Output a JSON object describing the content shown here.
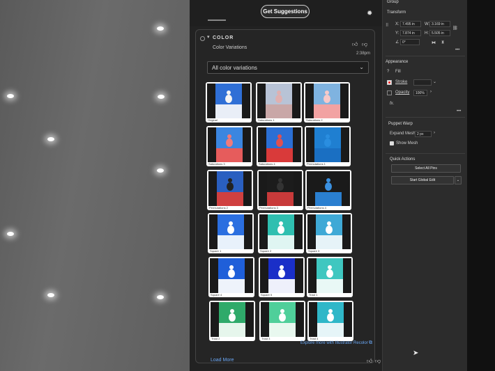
{
  "suggestions": {
    "get_label": "Get Suggestions"
  },
  "color_section": {
    "title": "COLOR",
    "subtitle": "Color Variations",
    "time": "2:38pm",
    "dropdown_value": "All color variations",
    "tiles": [
      {
        "caption": "Original",
        "sky": "#2f6fd6",
        "ground": "#e9eef7",
        "snow": "#f4f4f4",
        "bg": "#ffffff"
      },
      {
        "caption": "Saturations 1",
        "sky": "#b8c3d6",
        "ground": "#c9a7a7",
        "snow": "#e0b0b0",
        "bg": "#ffffff"
      },
      {
        "caption": "Saturations 2",
        "sky": "#7fb3e0",
        "ground": "#f2a2a2",
        "snow": "#f7c9c9",
        "bg": "#ffffff"
      },
      {
        "caption": "Saturations 3",
        "sky": "#3b86e0",
        "ground": "#e65c5c",
        "snow": "#f07a7a",
        "bg": "#ffffff"
      },
      {
        "caption": "Saturations 4",
        "sky": "#2b6fd4",
        "ground": "#d93a3a",
        "snow": "#e05050",
        "bg": "#ffffff"
      },
      {
        "caption": "Permutations 1",
        "sky": "#1f7fd1",
        "ground": "#1a6fc2",
        "snow": "#2a8ee0",
        "bg": "#ffffff"
      },
      {
        "caption": "Permutations 2",
        "sky": "#2a5fc0",
        "ground": "#d04040",
        "snow": "#222222",
        "bg": "#ffffff"
      },
      {
        "caption": "Permutations 3",
        "sky": "#1c1c1c",
        "ground": "#c83a3a",
        "snow": "#333333",
        "bg": "#ffffff"
      },
      {
        "caption": "Permutations 4",
        "sky": "#1a1a1a",
        "ground": "#2a7fd0",
        "snow": "#3a90e0",
        "bg": "#ffffff"
      },
      {
        "caption": "Square 1",
        "sky": "#2b6fe0",
        "ground": "#e8f1fb",
        "snow": "#ffffff",
        "bg": "#ffffff"
      },
      {
        "caption": "Square 2",
        "sky": "#2fbfb0",
        "ground": "#dff5f2",
        "snow": "#ffffff",
        "bg": "#ffffff"
      },
      {
        "caption": "Square 3",
        "sky": "#3fa9d6",
        "ground": "#e6f3f8",
        "snow": "#ffffff",
        "bg": "#ffffff"
      },
      {
        "caption": "Square 4",
        "sky": "#1f5fd9",
        "ground": "#eef3fb",
        "snow": "#ffffff",
        "bg": "#ffffff"
      },
      {
        "caption": "Square 5",
        "sky": "#1a2fc8",
        "ground": "#eef0fb",
        "snow": "#ffffff",
        "bg": "#ffffff"
      },
      {
        "caption": "Triad 1",
        "sky": "#3fc7c0",
        "ground": "#e9f8f6",
        "snow": "#ffffff",
        "bg": "#ffffff"
      },
      {
        "caption": "Triad 2",
        "sky": "#2faa6a",
        "ground": "#e6f6ec",
        "snow": "#ffffff",
        "bg": "#ffffff"
      },
      {
        "caption": "Triad 3",
        "sky": "#4fcf9a",
        "ground": "#e8f8ef",
        "snow": "#ffffff",
        "bg": "#ffffff"
      },
      {
        "caption": "Triad 4",
        "sky": "#2fb7c8",
        "ground": "#e6f5f8",
        "snow": "#ffffff",
        "bg": "#ffffff"
      }
    ],
    "explore_label": "Explore more with Illustrator Recolor",
    "load_more_label": "Load More"
  },
  "properties": {
    "group_label": "Group",
    "transform_label": "Transform",
    "x_label": "X:",
    "x_value": "7.495 in",
    "w_label": "W:",
    "w_value": "3.169 in",
    "y_label": "Y:",
    "y_value": "7.874 in",
    "h_label": "H:",
    "h_value": "5.505 in",
    "angle_value": "0°",
    "appearance_label": "Appearance",
    "fill_label": "Fill",
    "stroke_label": "Stroke",
    "opacity_label": "Opacity",
    "opacity_value": "100%",
    "fx_label": "fx.",
    "puppet_label": "Puppet Warp",
    "expand_label": "Expand Mesh:",
    "expand_value": "2 px",
    "show_mesh_label": "Show Mesh",
    "quick_actions_label": "Quick Actions",
    "select_pins_label": "Select All Pins",
    "global_edit_label": "Start Global Edit"
  }
}
